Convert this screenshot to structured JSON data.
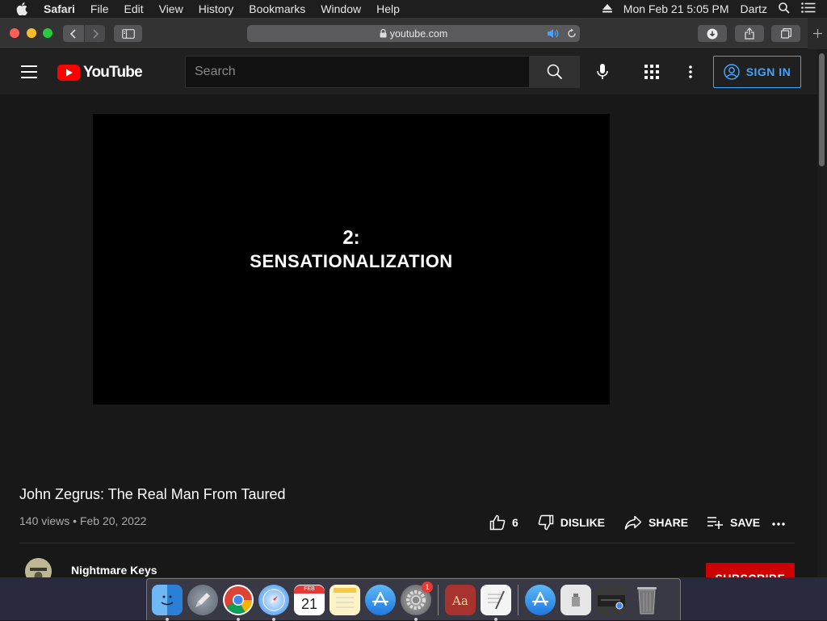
{
  "menubar": {
    "app_name": "Safari",
    "items": [
      "File",
      "Edit",
      "View",
      "History",
      "Bookmarks",
      "Window",
      "Help"
    ],
    "datetime": "Mon Feb 21  5:05 PM",
    "user": "Dartz"
  },
  "browser": {
    "url": "youtube.com"
  },
  "youtube": {
    "logo_text": "YouTube",
    "search_placeholder": "Search",
    "sign_in_label": "SIGN IN",
    "video_frame": {
      "number": "2:",
      "title": "SENSATIONALIZATION"
    },
    "video_title": "John Zegrus: The Real Man From Taured",
    "views": "140 views",
    "separator": "•",
    "date": "Feb 20, 2022",
    "likes": "6",
    "dislike_label": "DISLIKE",
    "share_label": "SHARE",
    "save_label": "SAVE",
    "channel_name": "Nightmare Keys",
    "subscribe_label": "SUBSCRIBE"
  },
  "dock": {
    "calendar_month": "FEB",
    "calendar_day": "21",
    "system_prefs_badge": "1"
  },
  "colors": {
    "youtube_red": "#ff0000",
    "link_blue": "#3ea6ff",
    "subscribe_red": "#cc0000"
  }
}
